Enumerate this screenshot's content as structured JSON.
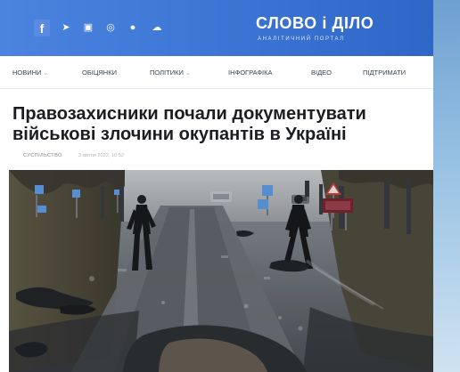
{
  "site": {
    "brand_name": "СЛОВО і ДІЛО",
    "brand_tagline": "АНАЛІТИЧНИЙ ПОРТАЛ",
    "social_icons": [
      "facebook-icon",
      "telegram-icon",
      "youtube-icon",
      "instagram-icon",
      "viber-icon",
      "cloud-icon"
    ]
  },
  "nav": {
    "items": [
      {
        "label": "НОВИНИ",
        "has_caret": true
      },
      {
        "label": "ОБІЦЯНКИ",
        "has_caret": false
      },
      {
        "label": "ПОЛІТИКИ",
        "has_caret": true
      },
      {
        "label": "ІНФОГРАФІКА",
        "has_caret": false
      },
      {
        "label": "ВІДЕО",
        "has_caret": false
      },
      {
        "label": "ПІДТРИМАТИ",
        "has_caret": false
      }
    ]
  },
  "article": {
    "title": "Правозахисники почали документувати військові злочини окупантів в Україні",
    "category": "СУСПІЛЬСТВО",
    "date": "3 квітня 2022, 10:52"
  },
  "colors": {
    "topbar": "#3f76d6",
    "page_bg": "#ffffff",
    "title_text": "#1b1d21",
    "nav_text": "#324352"
  }
}
